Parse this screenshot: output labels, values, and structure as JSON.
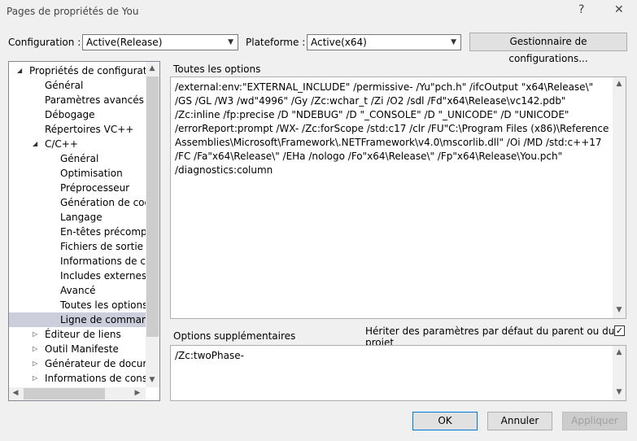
{
  "window": {
    "title": "Pages de propriétés de You",
    "help": "?",
    "close": "✕"
  },
  "config": {
    "label": "Configuration :",
    "value": "Active(Release)",
    "platform_label": "Plateforme :",
    "platform_value": "Active(x64)",
    "manager_button": "Gestionnaire de configurations..."
  },
  "tree": {
    "items": [
      {
        "label": "Propriétés de configuration",
        "level": 0,
        "expander": "expanded"
      },
      {
        "label": "Général",
        "level": 1
      },
      {
        "label": "Paramètres avancés",
        "level": 1
      },
      {
        "label": "Débogage",
        "level": 1
      },
      {
        "label": "Répertoires VC++",
        "level": 1
      },
      {
        "label": "C/C++",
        "level": 1,
        "expander": "expanded"
      },
      {
        "label": "Général",
        "level": 2
      },
      {
        "label": "Optimisation",
        "level": 2
      },
      {
        "label": "Préprocesseur",
        "level": 2
      },
      {
        "label": "Génération de code",
        "level": 2
      },
      {
        "label": "Langage",
        "level": 2
      },
      {
        "label": "En-têtes précompilés",
        "level": 2
      },
      {
        "label": "Fichiers de sortie",
        "level": 2
      },
      {
        "label": "Informations de consultation",
        "level": 2
      },
      {
        "label": "Includes externes",
        "level": 2
      },
      {
        "label": "Avancé",
        "level": 2
      },
      {
        "label": "Toutes les options",
        "level": 2
      },
      {
        "label": "Ligne de commande",
        "level": 2,
        "selected": true
      },
      {
        "label": "Éditeur de liens",
        "level": 1,
        "expander": "collapsed"
      },
      {
        "label": "Outil Manifeste",
        "level": 1,
        "expander": "collapsed"
      },
      {
        "label": "Générateur de documents XML",
        "level": 1,
        "expander": "collapsed"
      },
      {
        "label": "Informations de consultation",
        "level": 1,
        "expander": "collapsed"
      }
    ]
  },
  "main": {
    "all_options_label": "Toutes les options",
    "all_options_text": "/external:env:\"EXTERNAL_INCLUDE\" /permissive- /Yu\"pch.h\" /ifcOutput \"x64\\Release\\\" /GS /GL /W3 /wd\"4996\" /Gy /Zc:wchar_t /Zi /O2 /sdl /Fd\"x64\\Release\\vc142.pdb\" /Zc:inline /fp:precise /D \"NDEBUG\" /D \"_CONSOLE\" /D \"_UNICODE\" /D \"UNICODE\" /errorReport:prompt /WX- /Zc:forScope /std:c17 /clr /FU\"C:\\Program Files (x86)\\Reference Assemblies\\Microsoft\\Framework\\.NETFramework\\v4.0\\mscorlib.dll\" /Oi /MD /std:c++17 /FC /Fa\"x64\\Release\\\" /EHa /nologo /Fo\"x64\\Release\\\" /Fp\"x64\\Release\\You.pch\" /diagnostics:column",
    "additional_label": "Options supplémentaires",
    "inherit_label": "Hériter des paramètres par défaut du parent ou du projet",
    "inherit_checked": true,
    "additional_text": "/Zc:twoPhase-"
  },
  "footer": {
    "ok": "OK",
    "cancel": "Annuler",
    "apply": "Appliquer"
  }
}
